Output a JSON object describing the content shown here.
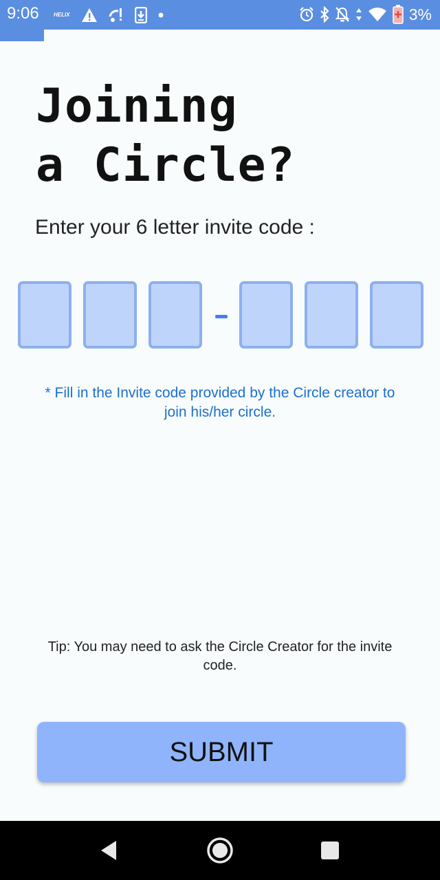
{
  "status_bar": {
    "time": "9:06",
    "carrier_logo_text": "HELIX",
    "battery_percent": "3%",
    "icons": [
      "helix-logo",
      "warning-icon",
      "wifi-alert-icon",
      "download-icon",
      "dot-icon",
      "alarm-icon",
      "bluetooth-icon",
      "bell-off-icon",
      "data-arrows-icon",
      "wifi-icon",
      "battery-low-icon"
    ],
    "background_color": "#5a8ee0"
  },
  "page": {
    "title_line1": "Joining",
    "title_line2": "a Circle?",
    "subtitle": "Enter your 6 letter invite code :"
  },
  "invite_code": {
    "boxes": [
      "",
      "",
      "",
      "",
      "",
      ""
    ],
    "separator": "-",
    "box_fill_color": "#bfd4fb",
    "box_border_color": "#8db0ee"
  },
  "hint": "* Fill in the Invite code provided by the Circle creator to join his/her circle.",
  "tip": "Tip: You may need to ask the Circle Creator for the invite code.",
  "submit_label": "SUBMIT",
  "colors": {
    "accent": "#5a8ee0",
    "button": "#8fb4fb",
    "hint_text": "#1c6fd1"
  },
  "nav_bar": {
    "buttons": [
      "back-icon",
      "home-icon",
      "recents-icon"
    ]
  }
}
